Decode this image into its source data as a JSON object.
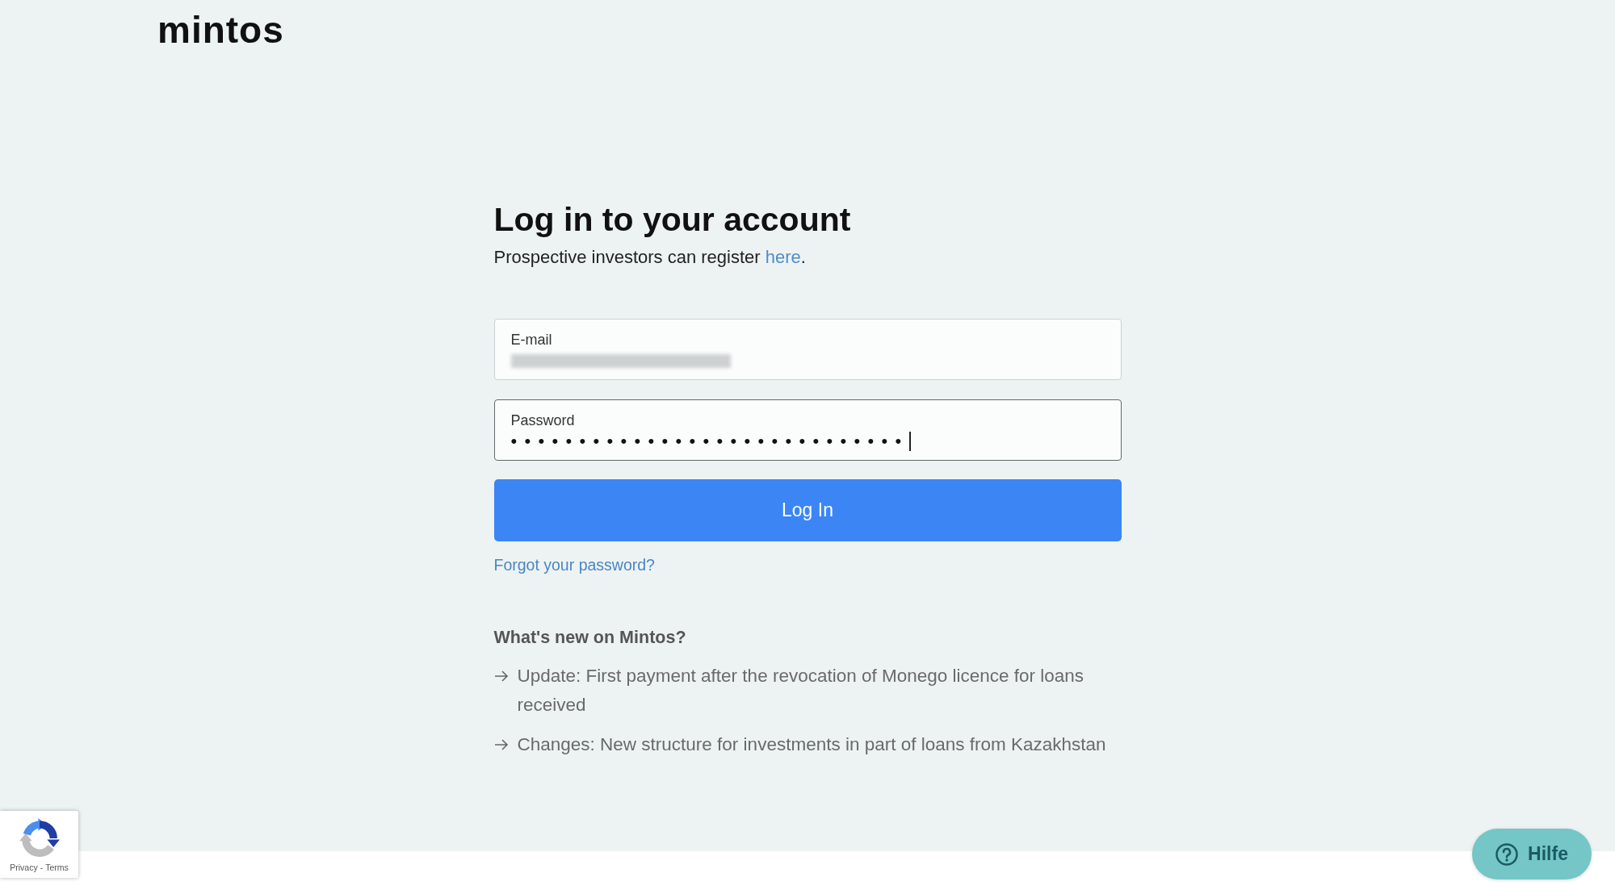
{
  "logo": {
    "text": "mintos"
  },
  "heading": "Log in to your account",
  "subtitle": {
    "text": "Prospective investors can register ",
    "link": "here",
    "suffix": "."
  },
  "form": {
    "email_field": {
      "label": "E-mail",
      "redacted": true,
      "focused": false
    },
    "password_field": {
      "label": "Password",
      "value": "•••••••••••••••••••••••••••••",
      "focused": true
    },
    "submit_button": "Log In",
    "forgot_link": "Forgot your password?"
  },
  "news": {
    "title": "What's new on Mintos?",
    "items": [
      "Update: First payment after the revocation of Monego licence for loans received",
      "Changes: New structure for investments in part of loans from Kazakhstan"
    ]
  },
  "recaptcha": {
    "links": [
      "Privacy",
      "Terms"
    ],
    "separator": "-"
  },
  "help_button": {
    "label": "Hilfe"
  }
}
